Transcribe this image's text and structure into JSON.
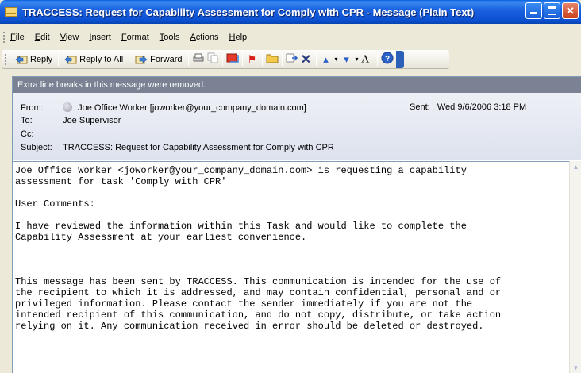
{
  "window": {
    "title": "TRACCESS: Request for Capability Assessment for Comply with CPR - Message (Plain Text)",
    "icon": "envelope-icon"
  },
  "menu": [
    "File",
    "Edit",
    "View",
    "Insert",
    "Format",
    "Tools",
    "Actions",
    "Help"
  ],
  "toolbar": {
    "reply": "Reply",
    "reply_all": "Reply to All",
    "forward": "Forward"
  },
  "infobar": "Extra line breaks in this message were removed.",
  "header": {
    "from_label": "From:",
    "from_value": "Joe Office Worker [joworker@your_company_domain.com]",
    "to_label": "To:",
    "to_value": "Joe Supervisor",
    "cc_label": "Cc:",
    "cc_value": "",
    "subject_label": "Subject:",
    "subject_value": "TRACCESS: Request for Capability Assessment for Comply with CPR",
    "sent_label": "Sent:",
    "sent_value": "Wed 9/6/2006 3:18 PM"
  },
  "body": [
    "Joe Office Worker <joworker@your_company_domain.com> is requesting a capability",
    "assessment for task 'Comply with CPR'",
    "",
    "User Comments:",
    "",
    "I have reviewed the information within this Task and would like to complete the",
    "Capability Assessment at your earliest convenience.",
    "",
    "",
    "",
    "This message has been sent by TRACCESS. This communication is intended for the use of",
    "the recipient to which it is addressed, and may contain confidential, personal and or",
    "privileged information. Please contact the sender immediately if you are not the",
    "intended recipient of this communication, and do not copy, distribute, or take action",
    "relying on it. Any communication received in error should be deleted or destroyed."
  ],
  "colors": {
    "titlebar": "#1b62e0",
    "infobar": "#7a8294",
    "header_bg": "#e4e8f1"
  }
}
